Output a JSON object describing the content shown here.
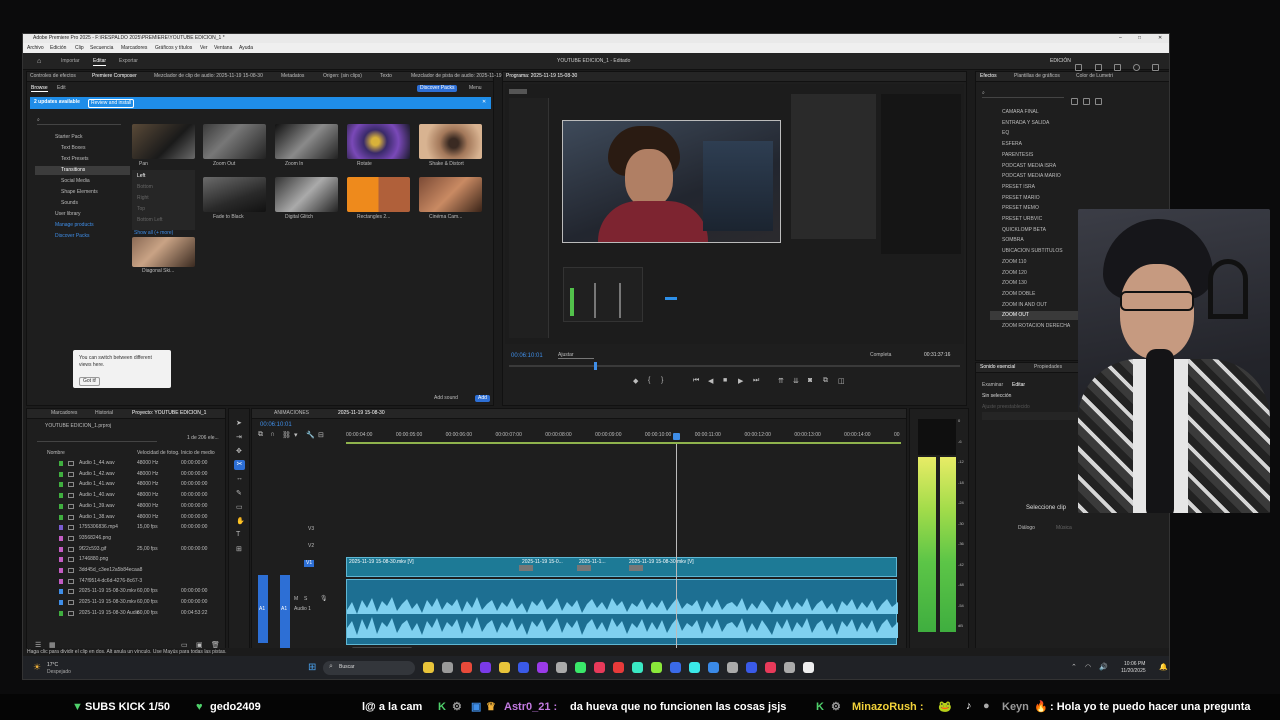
{
  "app": {
    "title": "Adobe Premiere Pro 2025 - F:\\RESPALDO 2025\\PREMIERE\\YOUTUBE EDICION_1 *",
    "menu": [
      "Archivo",
      "Edición",
      "Clip",
      "Secuencia",
      "Marcadores",
      "Gráficos y títulos",
      "Ver",
      "Ventana",
      "Ayuda"
    ],
    "workspace_tabs": [
      "Importar",
      "Editar",
      "Exportar"
    ],
    "project_title": "YOUTUBE EDICION_1 - Editado",
    "edition_label": "EDICIÓN"
  },
  "source_panel": {
    "tabs": [
      "Controles de efectos",
      "Premiere Composer",
      "Mezclador de clip de audio: 2025-11-19 15-08-30",
      "Metadatos",
      "Origen: (sin clips)",
      "Texto",
      "Mezclador de pista de audio: 2025-11-19"
    ],
    "subtabs": [
      "Browse",
      "Edit"
    ],
    "discover_button": "Discover Packs",
    "menu_button": "Menu",
    "update_banner": "2 updates available",
    "review_button": "Review and install",
    "tree": [
      "Starter Pack",
      "Text Boxes",
      "Text Presets",
      "Transitions",
      "Social Media",
      "Shape Elements",
      "Sounds",
      "User library",
      "Manage products",
      "Discover Packs"
    ],
    "pan_options": [
      "Left",
      "Bottom",
      "Right",
      "Top",
      "Bottom Left"
    ],
    "show_all": "Show all (+ more)",
    "thumbs": [
      "Pan",
      "Zoom Out",
      "Zoom In",
      "Rotate",
      "Shake & Distort",
      "Fade to Black",
      "Digital Glitch",
      "Rectangles 2...",
      "Cinéma Cam...",
      "Diagonal Ski..."
    ],
    "tooltip_text": "You can switch between different views here.",
    "tooltip_button": "Got it!",
    "add_sound": "Add sound",
    "add_button": "Add"
  },
  "program_panel": {
    "tab": "Programa: 2025-11-19 15-08-30",
    "timecode": "00:06:10:01",
    "fit": "Ajustar",
    "quality": "Completa",
    "duration": "00:31:37:16"
  },
  "effects_panel": {
    "tabs": [
      "Efectos",
      "Plantillas de gráficos",
      "Color de Lumetri"
    ],
    "presets": [
      "CAMARA FINAL",
      "ENTRADA Y SALIDA",
      "EQ",
      "ESFERA",
      "PARENTESIS",
      "PODCAST MEDIA ISRA",
      "PODCAST MEDIA MARIO",
      "PRESET ISRA",
      "PRESET MARIO",
      "PRESET MEMO",
      "PRESET URBVIC",
      "QUICKLOMP BETA",
      "SOMBRA",
      "UBICACION SUBTITULOS",
      "ZOOM 110",
      "ZOOM 120",
      "ZOOM 130",
      "ZOOM DOBLE",
      "ZOOM IN AND OUT",
      "ZOOM OUT",
      "ZOOM ROTACION DERECHA"
    ]
  },
  "essential_sound": {
    "tabs": [
      "Sonido esencial",
      "Propiedades"
    ],
    "subtabs": [
      "Examinar",
      "Editar"
    ],
    "no_selection": "Sin selección",
    "preset_label": "Ajuste preestablecido",
    "select_clip": "Seleccione clip",
    "dialog": "Diálogo",
    "music": "Música"
  },
  "project_panel": {
    "tabs": [
      "Marcadores",
      "Historial",
      "Proyecto: YOUTUBE EDICION_1"
    ],
    "project_file": "YOUTUBE EDICION_1.prproj",
    "count": "1 de 206 ele...",
    "columns": [
      "Nombre",
      "Velocidad de fotog.",
      "Inicio de medio"
    ],
    "rows": [
      {
        "name": "Audio 1_44.wav",
        "rate": "48000 Hz",
        "start": "00:00:00:00"
      },
      {
        "name": "Audio 1_42.wav",
        "rate": "48000 Hz",
        "start": "00:00:00:00"
      },
      {
        "name": "Audio 1_41.wav",
        "rate": "48000 Hz",
        "start": "00:00:00:00"
      },
      {
        "name": "Audio 1_40.wav",
        "rate": "48000 Hz",
        "start": "00:00:00:00"
      },
      {
        "name": "Audio 1_39.wav",
        "rate": "48000 Hz",
        "start": "00:00:00:00"
      },
      {
        "name": "Audio 1_38.wav",
        "rate": "48000 Hz",
        "start": "00:00:00:00"
      },
      {
        "name": "1755306836.mp4",
        "rate": "15,00 fps",
        "start": "00:00:00:00"
      },
      {
        "name": "93568246.png",
        "rate": "",
        "start": ""
      },
      {
        "name": "9f22c593.gif",
        "rate": "25,00 fps",
        "start": "00:00:00:00"
      },
      {
        "name": "1746880.png",
        "rate": "",
        "start": ""
      },
      {
        "name": "3dd45d_c3ee12a5b84ecaa8",
        "rate": "",
        "start": ""
      },
      {
        "name": "747f9514-dc6d-4276-8c67-3",
        "rate": "",
        "start": ""
      },
      {
        "name": "2025-11-19 15-08-30.mkv",
        "rate": "60,00 fps",
        "start": "00:00:00:00"
      },
      {
        "name": "2025-11-19 15-08-30.mkv",
        "rate": "60,00 fps",
        "start": "00:00:00:00"
      },
      {
        "name": "2025-11-19 15-08-30 Audio",
        "rate": "60,00 fps",
        "start": "00:04:53:22"
      }
    ]
  },
  "timeline": {
    "tabs": [
      "ANIMACIONES",
      "2025-11-19 15-08-30"
    ],
    "timecode": "00:06:10:01",
    "ruler": [
      "00:00:04:00",
      "00:00:05:00",
      "00:00:06:00",
      "00:00:07:00",
      "00:00:08:00",
      "00:00:09:00",
      "00:00:10:00",
      "00:00:11:00",
      "00:00:12:00",
      "00:00:13:00",
      "00:00:14:00",
      "00"
    ],
    "tracks_video": [
      "V3",
      "V2",
      "V1"
    ],
    "tracks_audio": [
      "A1",
      "A2"
    ],
    "audio_track_name": "Audio 1",
    "clip_labels": [
      "2025-11-19 15-08-30.mkv [V]",
      "2025-11-19 15-0...",
      "2025-11-1...",
      "2025-11-19 15-08-30.mkv [V]"
    ],
    "meter_scale": [
      "0",
      "-6",
      "-12",
      "-18",
      "-24",
      "-30",
      "-36",
      "-42",
      "-48",
      "-54",
      "dB"
    ]
  },
  "status_bar": {
    "hint": "Haga clic para dividir el clip en dos. Alt anula un vínculo. Use Mayús para todas las pistas.",
    "weather_temp": "17°C",
    "weather_desc": "Despejado",
    "search": "Buscar",
    "time": "10:06 PM",
    "date": "11/20/2025"
  },
  "stream_ticker": {
    "subs": "SUBS KICK 1/50",
    "user1": "gedo2409",
    "msg_pre": "l@ a la cam",
    "user2": "Astr0_21 :",
    "msg2": "da hueva que no funcionen las cosas jsjs",
    "user3": "MinazoRush :",
    "user4": "Keyn",
    "msg4": ": Hola yo te puedo hacer una pregunta"
  }
}
